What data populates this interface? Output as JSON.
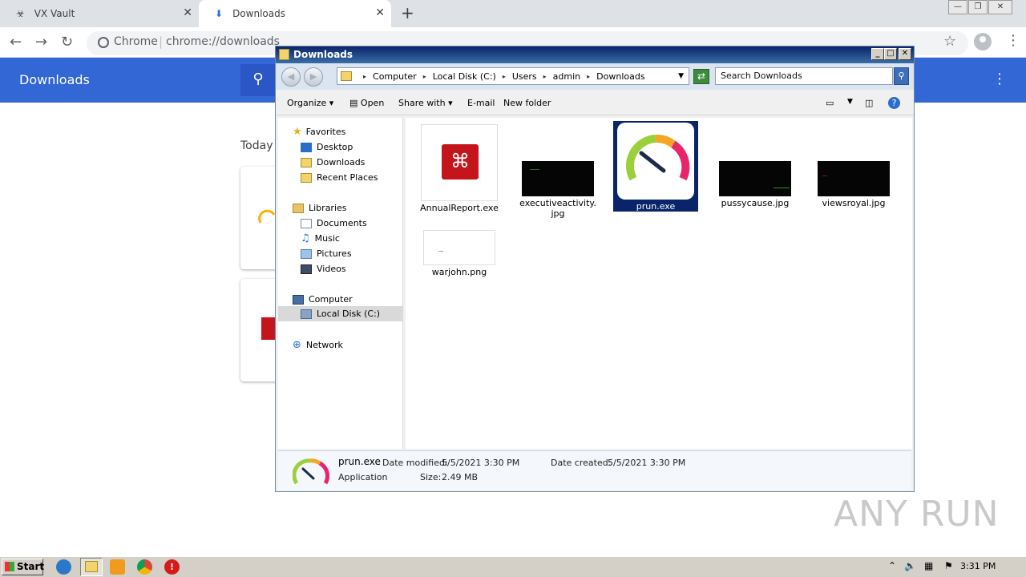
{
  "browser": {
    "tabs": [
      {
        "label": "VX Vault",
        "close": "✕"
      },
      {
        "label": "Downloads",
        "close": "✕"
      }
    ],
    "new_tab": "+",
    "omnibox": {
      "prefix": "Chrome",
      "separator": "|",
      "url": "chrome://downloads"
    },
    "page": {
      "title": "Downloads",
      "section": "Today"
    }
  },
  "explorer": {
    "title": "Downloads",
    "breadcrumb": [
      "Computer",
      "Local Disk (C:)",
      "Users",
      "admin",
      "Downloads"
    ],
    "search_placeholder": "Search Downloads",
    "commands": {
      "organize": "Organize",
      "open": "Open",
      "share_with": "Share with",
      "email": "E-mail",
      "new_folder": "New folder"
    },
    "nav": {
      "favorites": "Favorites",
      "desktop": "Desktop",
      "downloads": "Downloads",
      "recent": "Recent Places",
      "libraries": "Libraries",
      "documents": "Documents",
      "music": "Music",
      "pictures": "Pictures",
      "videos": "Videos",
      "computer": "Computer",
      "local_disk": "Local Disk (C:)",
      "network": "Network"
    },
    "files": [
      {
        "name": "AnnualReport.exe",
        "kind": "pdf-icon"
      },
      {
        "name": "executiveactivity.jpg",
        "kind": "dark-thumbnail"
      },
      {
        "name": "prun.exe",
        "kind": "gauge-icon",
        "selected": true
      },
      {
        "name": "pussycause.jpg",
        "kind": "dark-thumbnail"
      },
      {
        "name": "viewsroyal.jpg",
        "kind": "dark-thumbnail"
      },
      {
        "name": "warjohn.png",
        "kind": "light-thumbnail"
      }
    ],
    "details": {
      "name": "prun.exe",
      "modified_label": "Date modified:",
      "modified": "5/5/2021 3:30 PM",
      "created_label": "Date created:",
      "created": "5/5/2021 3:30 PM",
      "type": "Application",
      "size_label": "Size:",
      "size": "2.49 MB"
    }
  },
  "taskbar": {
    "start": "Start",
    "clock": "3:31 PM"
  },
  "watermark": "ANY RUN",
  "colors": {
    "chrome_header": "#3367d6",
    "selection": "#0a246a",
    "titlebar": "#0a246a"
  }
}
